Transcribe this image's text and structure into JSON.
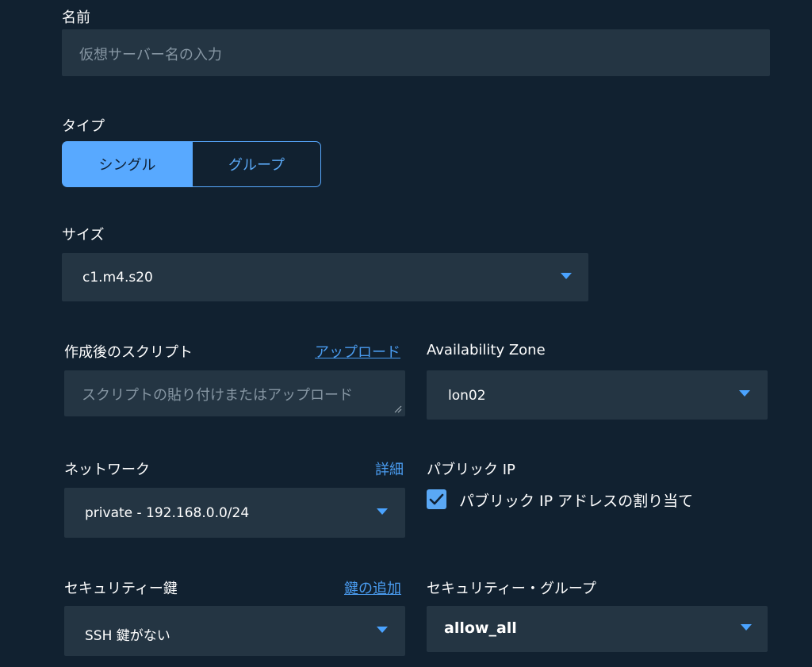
{
  "form": {
    "name": {
      "label": "名前",
      "placeholder": "仮想サーバー名の入力"
    },
    "type": {
      "label": "タイプ",
      "options": [
        "シングル",
        "グループ"
      ],
      "selected": "シングル"
    },
    "size": {
      "label": "サイズ",
      "value": "c1.m4.s20"
    },
    "script": {
      "label": "作成後のスクリプト",
      "link": "アップロード",
      "placeholder": "スクリプトの貼り付けまたはアップロード"
    },
    "availability_zone": {
      "label": "Availability Zone",
      "value": "lon02"
    },
    "network": {
      "label": "ネットワーク",
      "link": "詳細",
      "value": "private - 192.168.0.0/24"
    },
    "public_ip": {
      "label": "パブリック IP",
      "checkbox_label": "パブリック IP アドレスの割り当て",
      "checked": true
    },
    "security_key": {
      "label": "セキュリティー鍵",
      "link": "鍵の追加",
      "value": "SSH 鍵がない"
    },
    "security_group": {
      "label": "セキュリティー・グループ",
      "value": "allow_all"
    }
  },
  "colors": {
    "background": "#112130",
    "field": "#243543",
    "accent": "#4aa3ff",
    "segment_selected": "#58a9ff"
  },
  "icons": {
    "dropdown": "caret-down-icon",
    "checkbox": "checkmark-icon",
    "resize": "resize-handle-icon"
  }
}
